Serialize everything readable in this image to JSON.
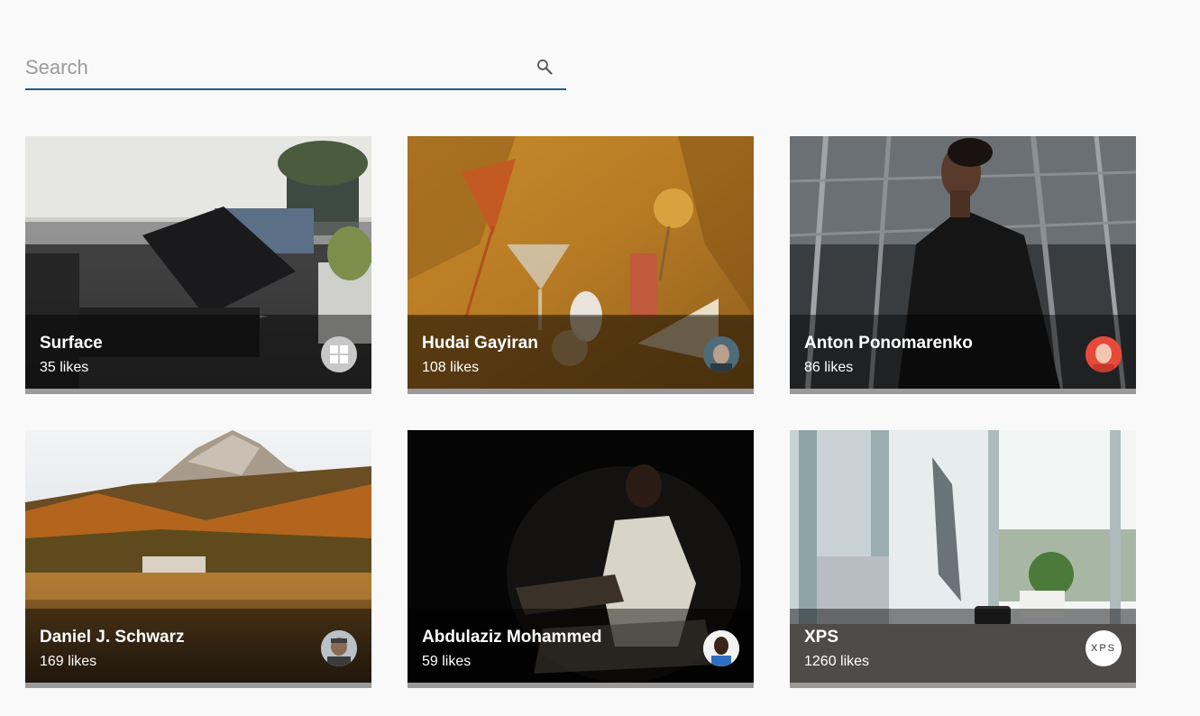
{
  "search": {
    "placeholder": "Search",
    "value": "",
    "icon": "search-icon"
  },
  "colors": {
    "accent": "#1d5d8b",
    "background": "#f9f9f9",
    "card_footer": "#9a9a9a"
  },
  "cards": [
    {
      "title": "Surface",
      "likes": "35 likes",
      "photo": "laptop on glass table",
      "avatar": "windows-logo"
    },
    {
      "title": "Hudai Gayiran",
      "likes": "108 likes",
      "photo": "dried flowers and vases still life",
      "avatar": "user-avatar"
    },
    {
      "title": "Anton Ponomarenko",
      "likes": "86 likes",
      "photo": "woman in leather jacket",
      "avatar": "user-avatar"
    },
    {
      "title": "Daniel J. Schwarz",
      "likes": "169 likes",
      "photo": "mountain lake autumn forest",
      "avatar": "user-avatar"
    },
    {
      "title": "Abdulaziz Mohammed",
      "likes": "59 likes",
      "photo": "boy reading in dark",
      "avatar": "user-avatar"
    },
    {
      "title": "XPS",
      "likes": "1260 likes",
      "photo": "laptop and monitor on desk by window",
      "avatar": "xps-logo",
      "avatar_text": "XPS"
    }
  ]
}
